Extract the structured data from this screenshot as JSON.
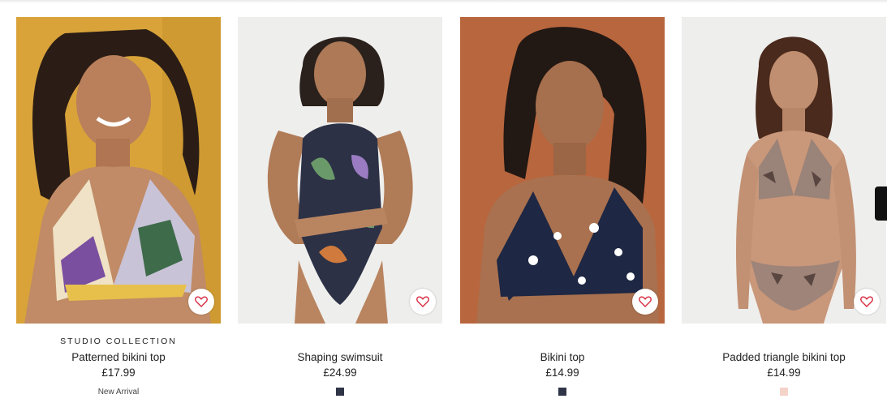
{
  "products": [
    {
      "brand": "STUDIO COLLECTION",
      "title": "Patterned bikini top",
      "price": "£17.99",
      "tag": "New Arrival",
      "swatch": null,
      "photo_bg": "#d9a33a",
      "favorite_icon": "heart-outline-icon"
    },
    {
      "brand": "",
      "title": "Shaping swimsuit",
      "price": "£24.99",
      "tag": "",
      "swatch": "#2f3547",
      "photo_bg": "#eeeeec",
      "favorite_icon": "heart-outline-icon"
    },
    {
      "brand": "",
      "title": "Bikini top",
      "price": "£14.99",
      "tag": "",
      "swatch": "#2f3547",
      "photo_bg": "#b8663e",
      "favorite_icon": "heart-outline-icon"
    },
    {
      "brand": "",
      "title": "Padded triangle bikini top",
      "price": "£14.99",
      "tag": "",
      "swatch": "#f4d3c8",
      "photo_bg": "#eeeeec",
      "favorite_icon": "heart-outline-icon"
    }
  ],
  "colors": {
    "heart": "#d62a3f",
    "arrow": "#111111"
  }
}
